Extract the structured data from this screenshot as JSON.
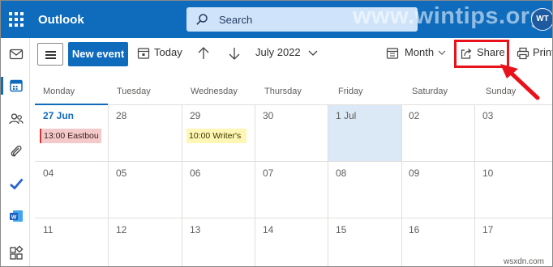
{
  "header": {
    "app_title": "Outlook",
    "search_placeholder": "Search",
    "watermark": "www.wintips.org",
    "avatar_initials": "WT"
  },
  "toolbar": {
    "new_event": "New event",
    "today": "Today",
    "month_label": "July 2022",
    "view": "Month",
    "share": "Share",
    "print": "Print"
  },
  "calendar": {
    "weekdays": [
      "Monday",
      "Tuesday",
      "Wednesday",
      "Thursday",
      "Friday",
      "Saturday",
      "Sunday"
    ],
    "weeks": [
      [
        "27 Jun",
        "28",
        "29",
        "30",
        "1 Jul",
        "02",
        "03"
      ],
      [
        "04",
        "05",
        "06",
        "07",
        "08",
        "09",
        "10"
      ],
      [
        "11",
        "12",
        "13",
        "14",
        "15",
        "16",
        "17"
      ]
    ],
    "events": [
      {
        "text": "13:00 Eastbou"
      },
      {
        "text": "10:00 Writer's"
      }
    ],
    "today_color": "#0f6cbd",
    "selected_day_color": "#dbe8f6"
  },
  "footer": {
    "site": "wsxdn.com"
  },
  "colors": {
    "brand": "#0f6cbd",
    "highlight": "#e8131a"
  }
}
